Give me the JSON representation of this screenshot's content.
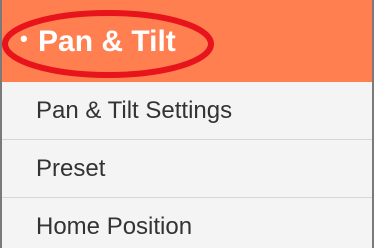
{
  "menu": {
    "header": {
      "bullet": "•",
      "title": "Pan & Tilt",
      "background_color": "#ff7f50",
      "highlight_color": "#e8141b"
    },
    "items": [
      {
        "label": "Pan & Tilt Settings"
      },
      {
        "label": "Preset"
      },
      {
        "label": "Home Position"
      }
    ]
  }
}
